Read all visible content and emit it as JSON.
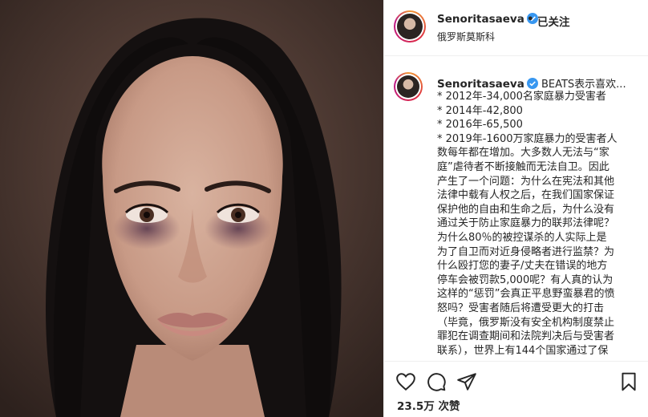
{
  "header": {
    "username": "Senoritasaeva",
    "separator": "•",
    "follow_status": "已关注",
    "location": "俄罗斯莫斯科"
  },
  "caption": {
    "username": "Senoritasaeva",
    "lead": "BEATS表示喜欢...",
    "lines": [
      "* 2012年-34,000名家庭暴力受害者",
      "* 2014年-42,800",
      "* 2016年-65,500",
      "* 2019年-1600万家庭暴力的受害者人",
      "数每年都在增加。大多数人无法与“家",
      "庭”虐待者不断接触而无法自卫。因此",
      "产生了一个问题：为什么在宪法和其他",
      "法律中载有人权之后，在我们国家保证",
      "保护他的自由和生命之后，为什么没有",
      "通过关于防止家庭暴力的联邦法律呢？",
      "为什么80％的被控谋杀的人实际上是",
      "为了自卫而对近身侵略者进行监禁？为",
      "什么殴打您的妻子/丈夫在错误的地方",
      "停车会被罚款5,000呢？有人真的认为",
      "这样的“惩罚”会真正平息野蛮暴君的愤",
      "怒吗？受害者随后将遭受更大的打击",
      "（毕竟，俄罗斯没有安全机构制度禁止",
      "罪犯在调查期间和法院判决后与受害者",
      "联系），世界上有144个国家通过了保"
    ]
  },
  "actions": {
    "likes_count": "23.5万",
    "likes_label": "次赞"
  },
  "icons": {
    "like": "heart-outline-icon",
    "comment": "speech-bubble-icon",
    "share": "paper-plane-icon",
    "save": "bookmark-icon",
    "verified": "verified-badge-icon"
  },
  "colors": {
    "verified_blue": "#3897f0",
    "text": "#262626",
    "border": "#efefef"
  }
}
